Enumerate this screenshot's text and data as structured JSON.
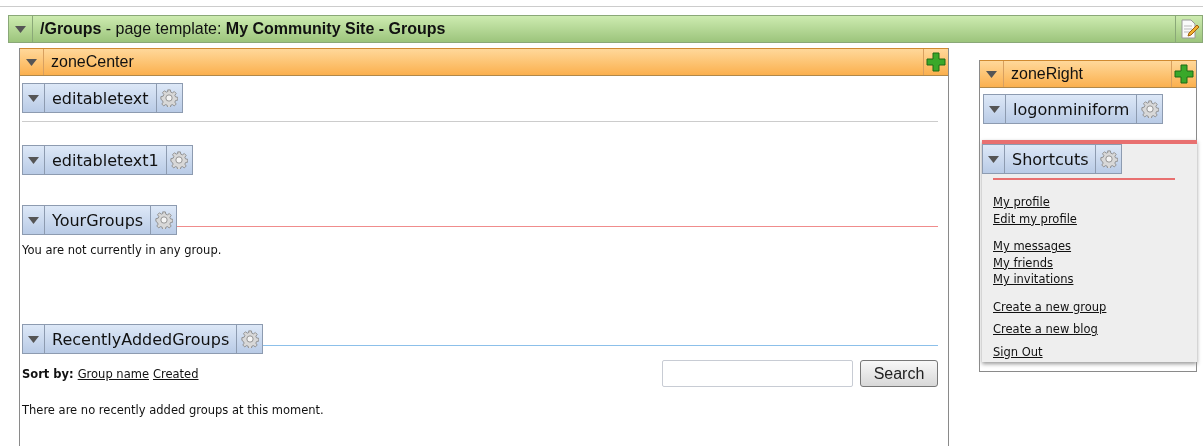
{
  "page_bar": {
    "title": "**/Groups** - page template: **My Community Site - Groups**"
  },
  "zones": [
    {
      "title": "zoneCenter",
      "webparts": [
        {
          "kind": "editabletext",
          "title": "editabletext"
        },
        {
          "kind": "editabletext",
          "title": "editabletext1"
        },
        {
          "kind": "text",
          "title": "YourGroups",
          "color": "#f08c8c",
          "message": "You are not currently in any group."
        },
        {
          "kind": "groups_list",
          "title": "RecentlyAddedGroups",
          "color": "#8cc0ea",
          "sort_label": "Sort by:",
          "sort_links": [
            "Group name",
            "Created"
          ],
          "search_button": "Search",
          "message": "There are no recently added groups at this moment."
        }
      ]
    },
    {
      "title": "zoneRight",
      "webparts": [
        {
          "kind": "logon",
          "title": "logonminiform"
        },
        {
          "kind": "shortcuts",
          "title": "Shortcuts",
          "color": "#e87070",
          "link_groups": [
            [
              "My profile",
              "Edit my profile"
            ],
            [
              "My messages",
              "My friends",
              "My invitations"
            ],
            [
              "Create a new group"
            ],
            [
              "Create a new blog"
            ],
            [
              "Sign Out"
            ]
          ]
        }
      ]
    }
  ]
}
